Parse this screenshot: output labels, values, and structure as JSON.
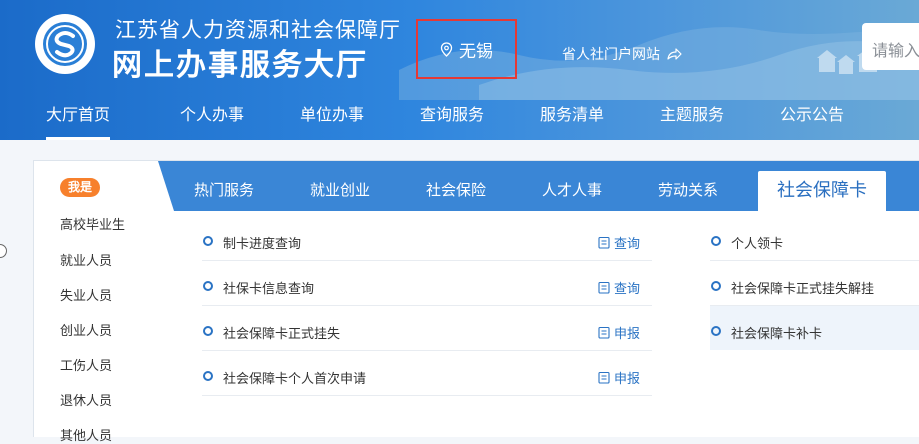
{
  "header": {
    "org_name": "江苏省人力资源和社会保障厅",
    "hall_name": "网上办事服务大厅",
    "location": "无锡",
    "portal_link": "省人社门户网站",
    "search_placeholder": "请输入"
  },
  "nav": {
    "items": [
      "大厅首页",
      "个人办事",
      "单位办事",
      "查询服务",
      "服务清单",
      "主题服务",
      "公示公告"
    ],
    "active": "大厅首页"
  },
  "sidebar": {
    "badge": "我是",
    "items": [
      "高校毕业生",
      "就业人员",
      "失业人员",
      "创业人员",
      "工伤人员",
      "退休人员",
      "其他人员"
    ]
  },
  "tabs": {
    "items": [
      "热门服务",
      "就业创业",
      "社会保险",
      "人才人事",
      "劳动关系"
    ],
    "active": "社会保障卡"
  },
  "services": {
    "left": [
      {
        "name": "制卡进度查询",
        "action": "查询"
      },
      {
        "name": "社保卡信息查询",
        "action": "查询"
      },
      {
        "name": "社会保障卡正式挂失",
        "action": "申报"
      },
      {
        "name": "社会保障卡个人首次申请",
        "action": "申报"
      }
    ],
    "right": [
      "个人领卡",
      "社会保障卡正式挂失解挂",
      "社会保障卡补卡"
    ]
  },
  "colors": {
    "header_blue": "#1b6bc9",
    "tab_blue": "#3a86d6",
    "badge_orange": "#f7802c",
    "link_blue": "#2a73c4",
    "alert_red": "#e53935"
  }
}
